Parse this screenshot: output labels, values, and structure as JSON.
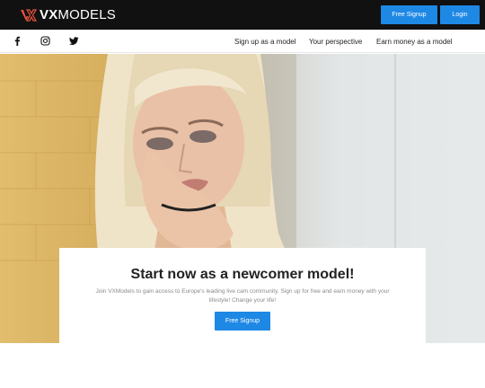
{
  "header": {
    "logo_bold": "VX",
    "logo_light": "MODELS",
    "signup_label": "Free Signup",
    "login_label": "Login"
  },
  "nav": {
    "social": [
      "facebook-icon",
      "instagram-icon",
      "twitter-icon"
    ],
    "links": [
      "Sign up as a model",
      "Your perspective",
      "Earn money as a model"
    ]
  },
  "hero": {
    "image": "model-portrait-photo"
  },
  "card": {
    "title": "Start now as a newcomer model!",
    "description": "Join VXModels to gain access to Europe's leading live cam community. Sign up for free and earn money with your lifestyle! Change your life!",
    "button_label": "Free Signup"
  },
  "colors": {
    "accent": "#1e88e5",
    "topbar": "#111111",
    "logo_mark": "#e8533d"
  }
}
